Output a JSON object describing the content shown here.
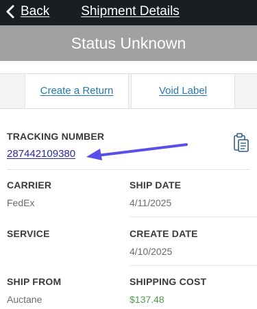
{
  "nav": {
    "back_label": "Back",
    "title": "Shipment Details"
  },
  "status": {
    "text": "Status Unknown"
  },
  "actions": {
    "create_return": "Create a Return",
    "void_label": "Void Label"
  },
  "tracking": {
    "label": "TRACKING NUMBER",
    "number": "287442109380"
  },
  "details": {
    "carrier_label": "CARRIER",
    "carrier": "FedEx",
    "ship_date_label": "SHIP DATE",
    "ship_date": "4/11/2025",
    "service_label": "SERVICE",
    "service": "",
    "create_date_label": "CREATE DATE",
    "create_date": "4/10/2025",
    "ship_from_label": "SHIP FROM",
    "ship_from": "Auctane",
    "shipping_cost_label": "SHIPPING COST",
    "shipping_cost": "$137.48"
  },
  "colors": {
    "nav_bg": "#1b1e21",
    "status_bg": "#a1a1a1",
    "link_blue": "#2379b8",
    "arrow_purple": "#5a4ee8",
    "cost_green": "#4f9a4f"
  },
  "icons": {
    "back": "chevron-left-icon",
    "copy": "clipboard-icon",
    "annotation": "arrow-icon"
  }
}
